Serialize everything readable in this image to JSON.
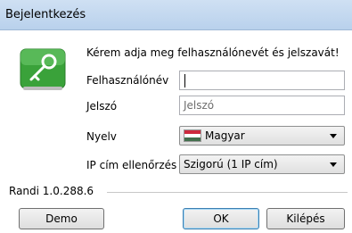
{
  "window": {
    "title": "Bejelentkezés"
  },
  "form": {
    "instruction": "Kérem adja meg felhasználónevét és jelszavát!",
    "username_label": "Felhasználónév",
    "username_value": "",
    "password_label": "Jelszó",
    "password_placeholder": "Jelszó",
    "language_label": "Nyelv",
    "language_value": "Magyar",
    "ip_check_label": "IP cím ellenőrzés",
    "ip_check_value": "Szigorú (1 IP cím)"
  },
  "footer": {
    "version": "Randi 1.0.288.6",
    "demo_label": "Demo",
    "ok_label": "OK",
    "exit_label": "Kilépés"
  },
  "icons": {
    "login_icon": "key-icon",
    "flag_icon": "hungary-flag-icon"
  },
  "colors": {
    "icon_green": "#3aa23a",
    "title_bg": "#c6daf1"
  }
}
